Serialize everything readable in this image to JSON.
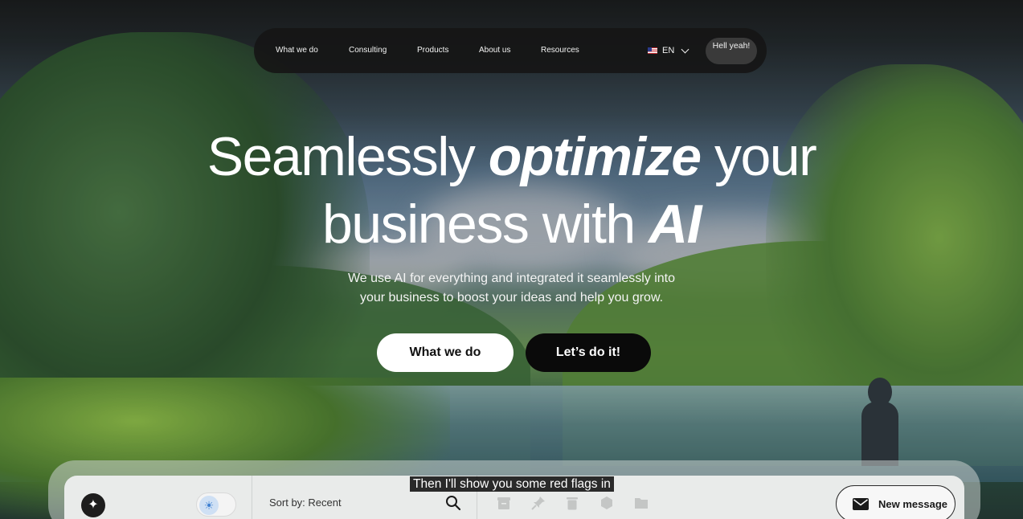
{
  "nav": {
    "links": [
      "What we do",
      "Consulting",
      "Products",
      "About us",
      "Resources"
    ],
    "language": "EN",
    "language_flag": "us-flag-icon",
    "cta": "Hell yeah!"
  },
  "hero": {
    "line1_start": "Seamlessly ",
    "line1_emphasis": "optimize",
    "line1_end": " your",
    "line2_start": "business with ",
    "line2_emphasis": "AI",
    "subtitle_line1": "We use AI for everything and integrated it seamlessly into",
    "subtitle_line2": "your business to boost your ideas and help you grow.",
    "primary_button": "What we do",
    "secondary_button": "Let’s do it!"
  },
  "app_preview": {
    "logo_icon": "sparkle-icon",
    "theme_toggle_icon": "sun-icon",
    "sort_label": "Sort by: Recent",
    "search_icon": "search-icon",
    "toolbar_icons": [
      "archive-icon",
      "pin-icon",
      "trash-icon",
      "tag-icon",
      "folder-icon"
    ],
    "new_message_label": "New message",
    "new_message_icon": "envelope-icon"
  },
  "caption": "Then I'll show you some red flags in",
  "colors": {
    "nav_bg": "#161616",
    "primary_button_bg": "#ffffff",
    "secondary_button_bg": "#0a0a0a",
    "text_on_dark": "#ffffff"
  }
}
